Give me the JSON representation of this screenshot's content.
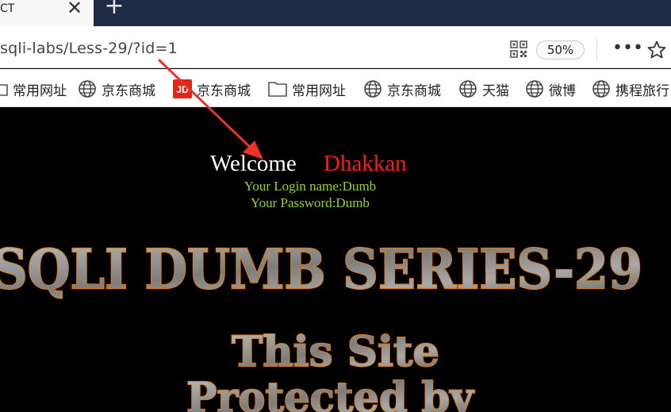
{
  "browser": {
    "tab": {
      "title": "CT",
      "close_glyph": "✕"
    },
    "new_tab_glyph": "+",
    "address": {
      "url": "sqli-labs/Less-29/?id=1",
      "zoom": "50%",
      "more_glyph": "•••"
    },
    "icons": {
      "qr": "qr-code-icon",
      "star": "star-icon",
      "close": "close-icon",
      "new_tab": "plus-icon",
      "more": "more-icon"
    },
    "bookmarks": [
      {
        "label": "常用网址",
        "icon": "folder-icon"
      },
      {
        "label": "京东商城",
        "icon": "globe-icon"
      },
      {
        "label": "京东商城",
        "icon": "jd-logo-icon"
      },
      {
        "label": "常用网址",
        "icon": "folder-icon"
      },
      {
        "label": "京东商城",
        "icon": "globe-icon"
      },
      {
        "label": "天猫",
        "icon": "globe-icon"
      },
      {
        "label": "微博",
        "icon": "globe-icon"
      },
      {
        "label": "携程旅行",
        "icon": "globe-icon"
      }
    ],
    "jd_logo_text": "JD"
  },
  "content": {
    "welcome": "Welcome",
    "user": "Dhakkan",
    "login_name": "Your Login name:Dumb",
    "password": "Your Password:Dumb",
    "banner_title": "SQLI DUMB SERIES-29",
    "banner_line1": "This Site",
    "banner_line2": "Protected by"
  },
  "colors": {
    "page_bg": "#000000",
    "welcome_text": "#ffffff",
    "user_text": "#ff1a1a",
    "login_text": "#8fd81e",
    "banner_fill": "#8a8a8a",
    "banner_glow": "#e07a10",
    "annotation_arrow": "#e8322a",
    "tabstrip": "#1f2a44"
  }
}
